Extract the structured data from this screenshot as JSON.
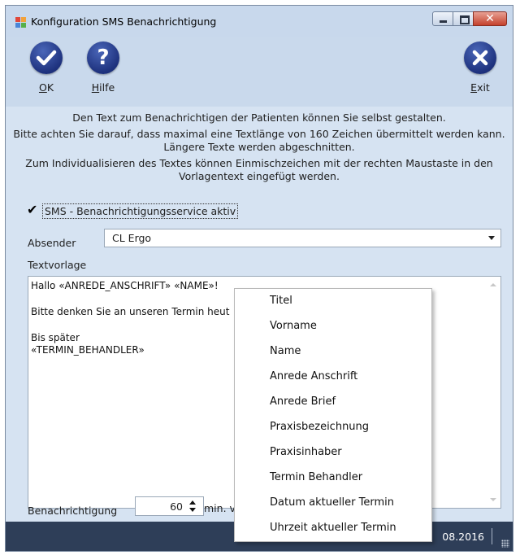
{
  "window": {
    "title": "Konfiguration SMS Benachrichtigung",
    "controls": {
      "minimize": "minimize",
      "maximize": "maximize",
      "close": "✕"
    }
  },
  "toolbar": {
    "ok": {
      "label_underlined": "O",
      "label_rest": "K",
      "icon": "check-icon"
    },
    "help": {
      "label_underlined": "H",
      "label_rest": "ilfe",
      "icon": "question-icon"
    },
    "exit": {
      "label_underlined": "E",
      "label_rest": "xit",
      "icon": "close-icon"
    }
  },
  "info": {
    "line1": "Den Text zum Benachrichtigen der Patienten können Sie selbst gestalten.",
    "line2": "Bitte achten Sie darauf, dass maximal eine Textlänge von 160 Zeichen übermittelt werden kann.",
    "line3": "Längere Texte werden abgeschnitten.",
    "line4": "Zum Individualisieren des Textes können Einmischzeichen mit der rechten Maustaste in den",
    "line5": "Vorlagentext eingefügt werden."
  },
  "sms_service": {
    "label": "SMS - Benachrichtigungsservice aktiv",
    "checked": true,
    "check_glyph": "✔"
  },
  "sender": {
    "label": "Absender",
    "value": "CL Ergo"
  },
  "template": {
    "label": "Textvorlage",
    "lines": [
      "Hallo «ANREDE_ANSCHRIFT» «NAME»!",
      "",
      "Bitte denken Sie an unseren Termin heut",
      "",
      "Bis später",
      "«TERMIN_BEHANDLER»"
    ]
  },
  "notification": {
    "label": "Benachrichtigung",
    "value": "60",
    "unit": "min. v"
  },
  "status": {
    "date": "08.2016"
  },
  "context_menu": {
    "items": [
      "Titel",
      "Vorname",
      "Name",
      "Anrede Anschrift",
      "Anrede Brief",
      "Praxisbezeichnung",
      "Praxisinhaber",
      "Termin Behandler",
      "Datum aktueller Termin",
      "Uhrzeit aktueller Termin"
    ]
  },
  "colors": {
    "chrome": "#c9d9ec",
    "content": "#d6e3f2",
    "statusbar": "#2e3e58",
    "toolbar_icon": "#1e327e",
    "close_button": "#c4412c"
  }
}
